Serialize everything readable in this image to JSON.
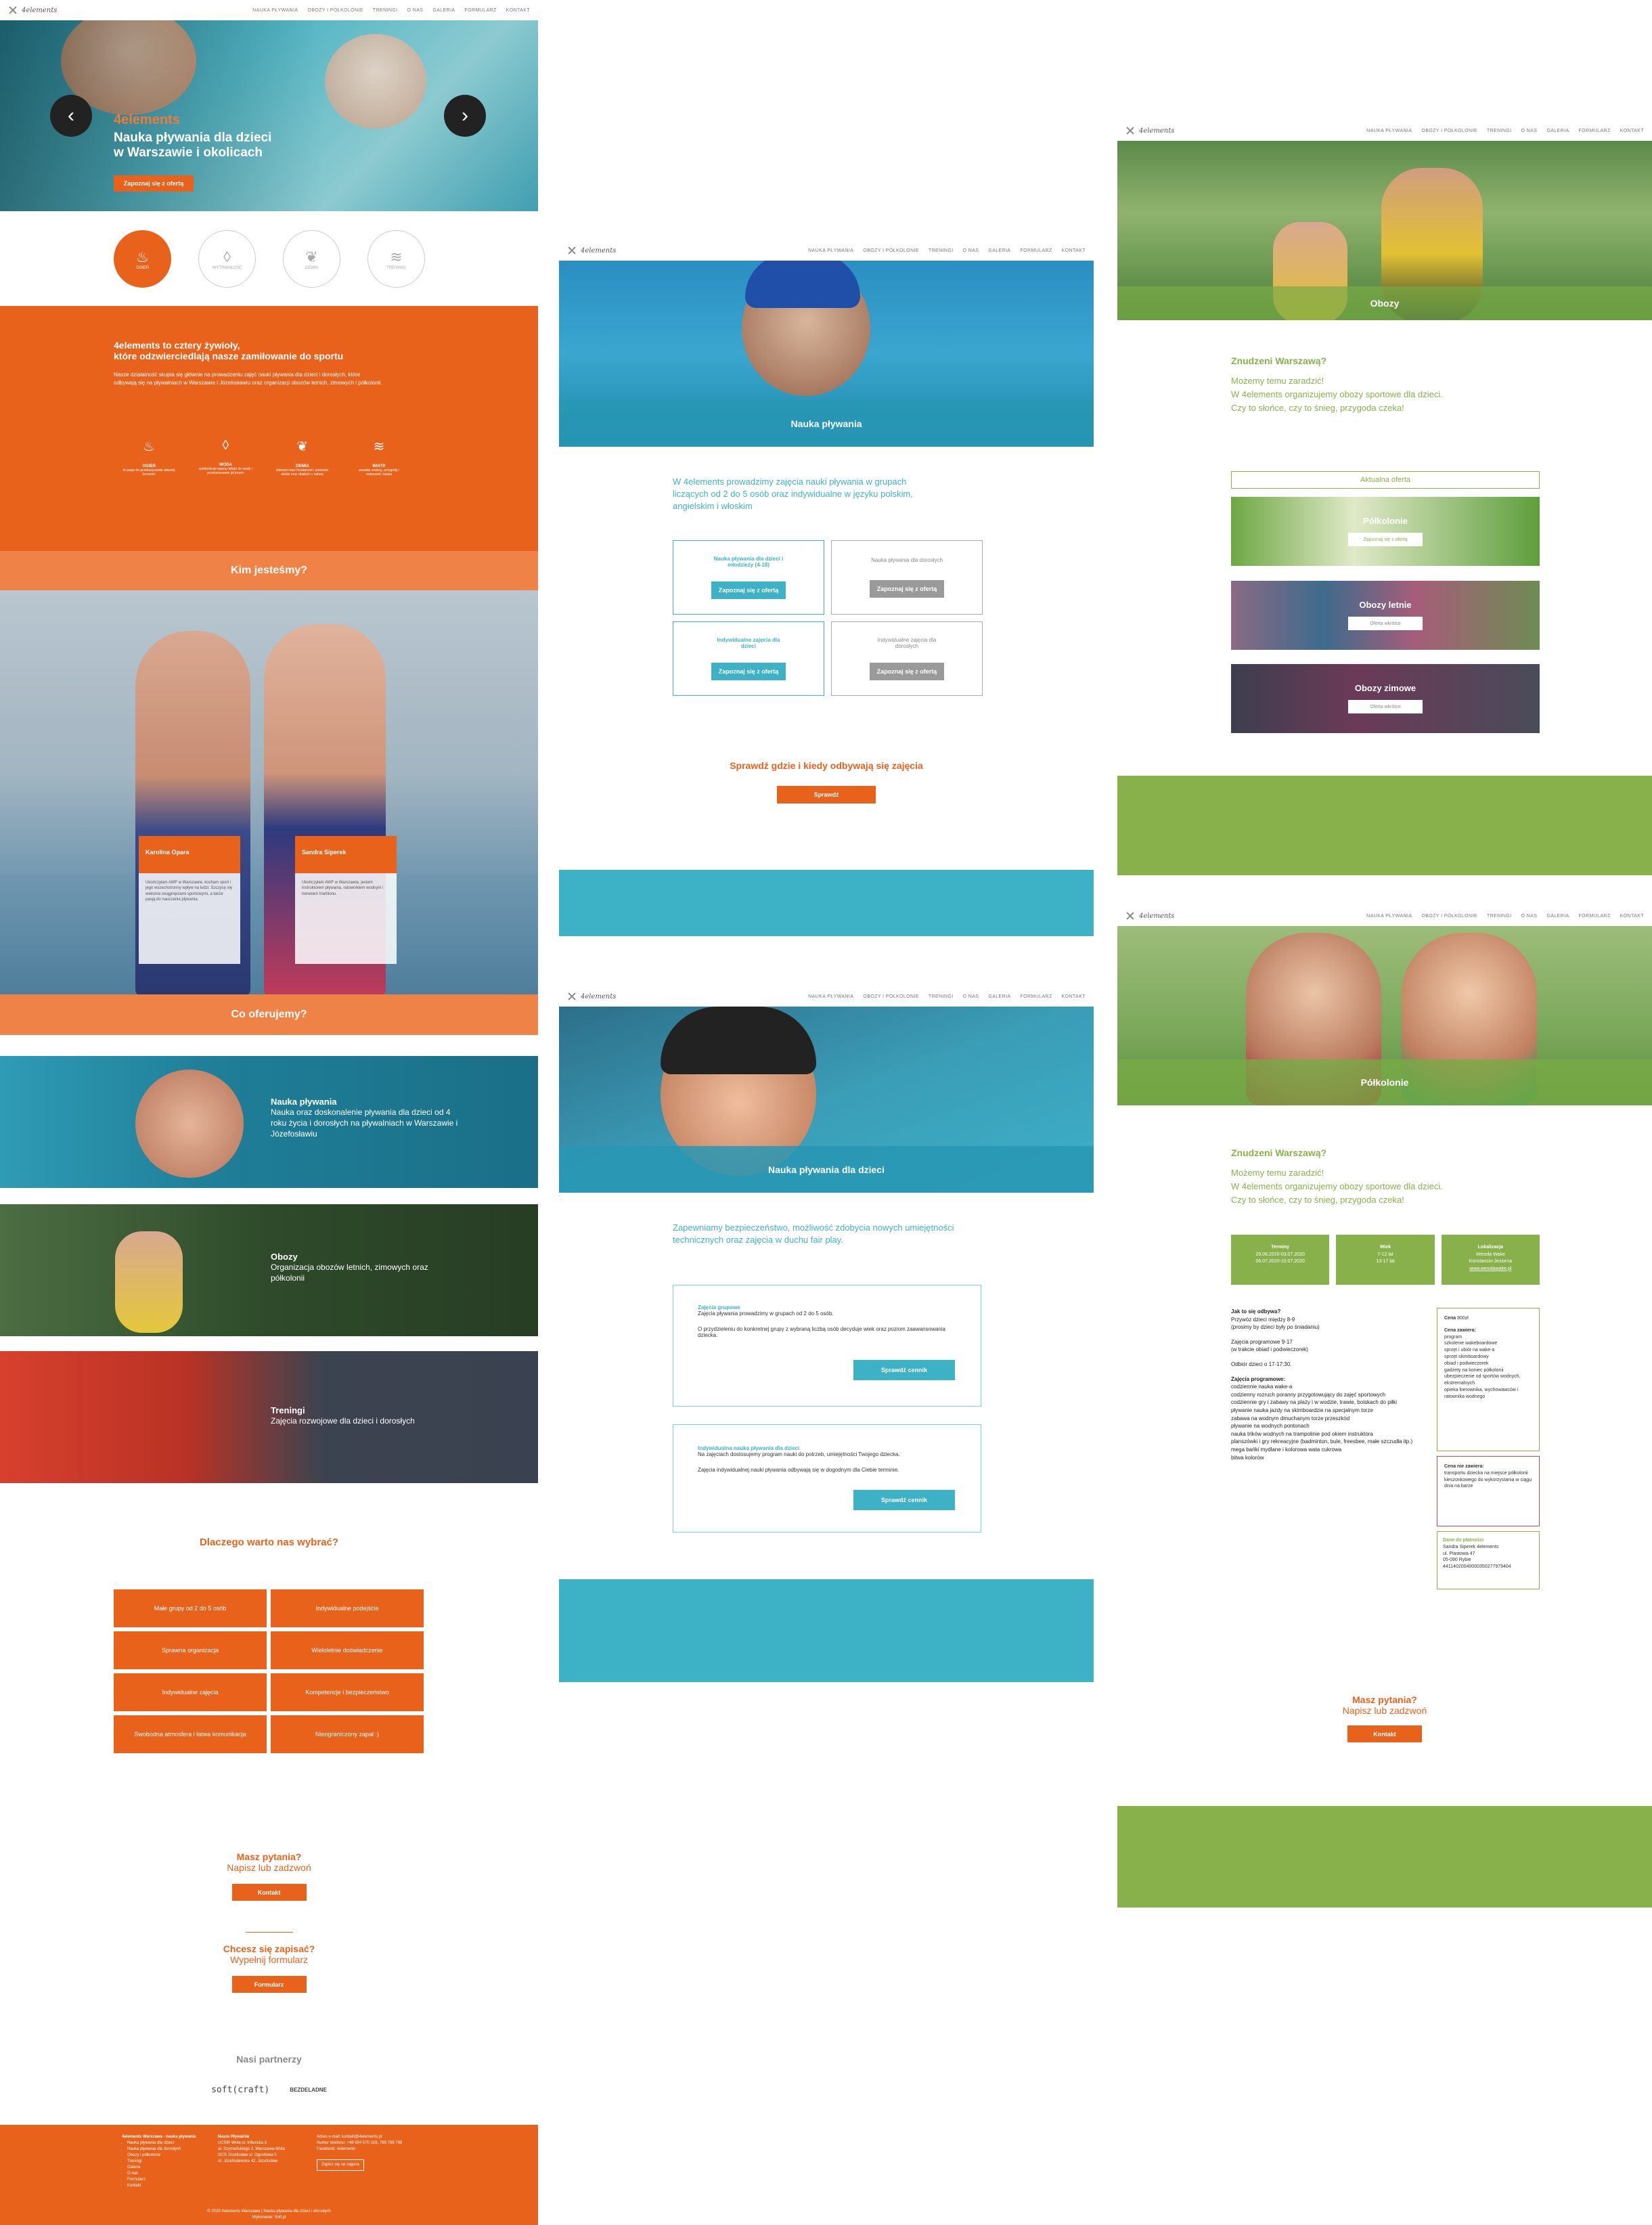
{
  "nav": {
    "logo": "4elements",
    "items": [
      "NAUKA PŁYWANIA",
      "OBOZY I PÓŁKOLONIE",
      "TRENINGI",
      "O NAS",
      "GALERIA",
      "FORMULARZ",
      "KONTAKT"
    ]
  },
  "page1": {
    "hero": {
      "brand": "4elements",
      "title_l1": "Nauka pływania dla dzieci",
      "title_l2": "w Warszawie i okolicach",
      "cta": "Zapoznaj się z ofertą"
    },
    "elements": [
      "OGIEŃ",
      "WYTRWAŁOŚĆ",
      "ZIEMIA",
      "TRENINGI"
    ],
    "intro": {
      "h1": "4elements to cztery żywioły,",
      "h2": "które odzwierciedlają nasze zamiłowanie do sportu",
      "body": "Nasze działalność skupia się głównie na prowadzeniu zajęć nauki pływania dla dzieci i dorosłych, które odbywają się na pływalniach w Warszawie i Józefosławiu oraz organizacji obozów letnich, zimowych i półkolonii.",
      "features": [
        {
          "label": "OGIEŃ",
          "text": "to pasja do przekazywania własnej liczności"
        },
        {
          "label": "WODA",
          "text": "symbolizuje naszą miłość do wody i przekazywanie jej innym"
        },
        {
          "label": "ZIEMIA",
          "text": "stanowi nasz fundament i pewność siebie oraz dbałość o naturę"
        },
        {
          "label": "WIATR",
          "text": "uosabia zmiany, przygodę i ciekawość świata"
        }
      ]
    },
    "who_title": "Kim jesteśmy?",
    "team": [
      {
        "name": "Karolina Opara",
        "bio": "Ukończyłam AWF w Warszawie, kocham sport i jego wszechstronny wpływ na ludzi. Szczycę się wieloma osiągnięciami sportowymi, a także pasją do nauczania pływania."
      },
      {
        "name": "Sandra Siperek",
        "bio": "Ukończyłam AWF w Warszawie, jestem instruktorem pływania, ratownikiem wodnym i trenerem triathlonu."
      }
    ],
    "offer_title": "Co oferujemy?",
    "offers": [
      {
        "title": "Nauka pływania",
        "text": "Nauka oraz doskonalenie pływania dla dzieci od 4 roku życia i dorosłych na pływalniach w Warszawie i Józefosławiu"
      },
      {
        "title": "Obozy",
        "text": "Organizacja obozów letnich, zimowych oraz półkolonii"
      },
      {
        "title": "Treningi",
        "text": "Zajęcia rozwojowe dla dzieci i dorosłych"
      }
    ],
    "why_title": "Dlaczego warto nas wybrać?",
    "why": [
      "Małe grupy od 2 do 5 osób",
      "Indywidualne podejście",
      "Sprawna organizacja",
      "Wieloletnie doświadczenie",
      "Indywidualne zajęcia",
      "Kompetencje i bezpieczeństwo",
      "Swobodna atmosfera i łatwa komunikacja",
      "Nieograniczony zapał :)"
    ],
    "questions": {
      "h": "Masz pytania?",
      "sub": "Napisz lub zadzwoń",
      "btn": "Kontakt"
    },
    "signup": {
      "h": "Chcesz się zapisać?",
      "sub": "Wypełnij formularz",
      "btn": "Formularz"
    },
    "partners_title": "Nasi partnerzy",
    "partners": [
      "soft(craft)",
      "BEZDELADNE"
    ],
    "footer": {
      "col1_title": "4elements Warszawa - nauka pływania",
      "col1": [
        "Nauka pływania dla dzieci",
        "Nauka pływania dla dorosłych",
        "Obozy i półkolonie",
        "Treningi",
        "Galeria",
        "O nas",
        "Formularz",
        "Kontakt"
      ],
      "col2_title": "Nasze Pływalnie",
      "col2": [
        "UCSiR Wola ul. Inflancka 8",
        "ul. Szymańskiego 2, Warszawa-Wola",
        "GCS Józefosław ul. Ogrodowa 5",
        "ul. Józefosławska 42, Józefosław"
      ],
      "col3": [
        "Adres e-mail: kontakt@4elements.pl",
        "Numer telefonu: +48 504 570 328, 799 799 799",
        "Facebook: 4elements"
      ],
      "col3_btn": "Zapisz się na zajęcia",
      "copy": "© 2020 4elements Warszawa | Nauka pływania dla dzieci i dorosłych",
      "credit": "Wykonanie: Soft.pl"
    }
  },
  "page2": {
    "banner": "Nauka pływania",
    "intro": "W 4elements prowadzimy zajęcia nauki pływania w grupach liczących od 2 do 5 osób oraz indywidualne w języku polskim, angielskim i włoskim",
    "cards": [
      {
        "title": "Nauka pływania dla dzieci i młodzieży (4-18)",
        "btn": "Zapoznaj się z ofertą",
        "active": true
      },
      {
        "title": "Nauka pływania dla dorosłych",
        "btn": "Zapoznaj się z ofertą",
        "active": false
      },
      {
        "title": "Indywidualne zajęcia dla dzieci",
        "btn": "Zapoznaj się z ofertą",
        "active": true
      },
      {
        "title": "Indywidualne zajęcia dla dorosłych",
        "btn": "Zapoznaj się z ofertą",
        "active": false
      }
    ],
    "where": "Sprawdź gdzie i kiedy odbywają się zajęcia",
    "where_btn": "Sprawdź"
  },
  "page3": {
    "banner": "Nauka pływania dla dzieci",
    "intro": "Zapewniamy bezpieczeństwo, możliwość zdobycia nowych umiejętności technicznych oraz zajęcia w duchu fair play.",
    "boxes": [
      {
        "title": "Zajęcia grupowe",
        "l1": "Zajęcia pływania prowadzimy w grupach od 2 do 5 osób.",
        "l2": "O przydzieleniu do konkretnej grupy z wybraną liczbą osób decyduje wiek oraz poziom zaawansowania dziecka.",
        "btn": "Sprawdź cennik"
      },
      {
        "title": "Indywidualna nauka pływania dla dzieci",
        "l1": "Na zajęciach dostosujemy program nauki do potrzeb, umiejętności Twojego dziecka.",
        "l2": "Zajęcia indywidualnej nauki pływania odbywają się w dogodnym dla Ciebie terminie.",
        "btn": "Sprawdź cennik"
      }
    ]
  },
  "page4": {
    "banner": "Obozy",
    "h": "Znudzeni Warszawą?",
    "l1": "Możemy temu zaradzić!",
    "l2": "W 4elements organizujemy obozy sportowe dla dzieci.",
    "l3": "Czy to słońce, czy to śnieg, przygoda czeka!",
    "offer_label": "Aktualna oferta",
    "offers": [
      {
        "title": "Półkolonie",
        "btn": "Zapoznaj się z ofertą"
      },
      {
        "title": "Obozy letnie",
        "btn": "Oferta wkrótce"
      },
      {
        "title": "Obozy zimowe",
        "btn": "Oferta wkrótce"
      }
    ]
  },
  "page5": {
    "banner": "Półkolonie",
    "h": "Znudzeni Warszawą?",
    "l1": "Możemy temu zaradzić!",
    "l2": "W 4elements organizujemy obozy sportowe dla dzieci.",
    "l3": "Czy to słońce, czy to śnieg, przygoda czeka!",
    "info": [
      {
        "title": "Terminy",
        "l1": "29.06.2020-03.07.2020",
        "l2": "06.07.2020-10.07.2020"
      },
      {
        "title": "Wiek",
        "l1": "7-12 lat",
        "l2": "13-17 lat"
      },
      {
        "title": "Lokalizacja",
        "l1": "Wesoła Wake",
        "l2": "Konstancin-Jeziorna",
        "l3": "www.wesolawake.pl"
      }
    ],
    "schedule_title": "Jak to się odbywa?",
    "schedule": [
      "Przywóz dzieci między 8-9",
      "(prosimy by dzieci były po śniadaniu)",
      "Zajęcia programowe 9-17",
      "(w trakcie obiad i podwieczorek)",
      "Odbiór dzieci o 17-17:30."
    ],
    "program_title": "Zajęcia programowe:",
    "program": [
      "codziennie nauka wake-a",
      "codzienny rozruch poranny przygotowujący do zajęć sportowych",
      "codziennie gry i zabawy na plaży i w wodzie, trawie, boiskach do piłki",
      "pływanie nauka jazdy na skimboardzie na specjalnym torze",
      "zabawa na wodnym dmuchanym torze przeszkód",
      "pływanie na wodnych pontonach",
      "nauka trików wodnych na trampolinie pod okiem instruktora",
      "planszówki i gry rekreacyjne (badminton, bule, freesbee, małe szczudła itp.)",
      "mega bańki mydlane i kolorowa wata cukrowa",
      "bitwa kolorów"
    ],
    "price_label": "Cena",
    "price": "800zł",
    "incl_title": "Cena zawiera:",
    "incl": [
      "program",
      "szkolenie wakeboardowe",
      "sprzęt i ubiór na wake-a",
      "sprzęt skimboardowy",
      "obiad i podwieczorek",
      "gadżety na koniec półkolonii",
      "ubezpieczenie od sportów wodnych, ekstremalnych",
      "opieka kierownika, wychowawców i ratownika wodnego"
    ],
    "excl_title": "Cena nie zawiera:",
    "excl": [
      "transportu dziecka na miejsce półkolonii",
      "kieszonkowego do wykorzystania w ciągu dnia na barze"
    ],
    "pay_title": "Dane do płatności",
    "pay": [
      "Sandra Siperek 4elements",
      "ul. Piastowa 47",
      "05-090 Rybie",
      "44114020040000350277979404"
    ],
    "questions": {
      "h": "Masz pytania?",
      "sub": "Napisz lub zadzwoń",
      "btn": "Kontakt"
    }
  },
  "colors": {
    "orange": "#e8621c",
    "teal": "#3db2c6",
    "green": "#88b04b",
    "gray": "#9a9a9a"
  }
}
